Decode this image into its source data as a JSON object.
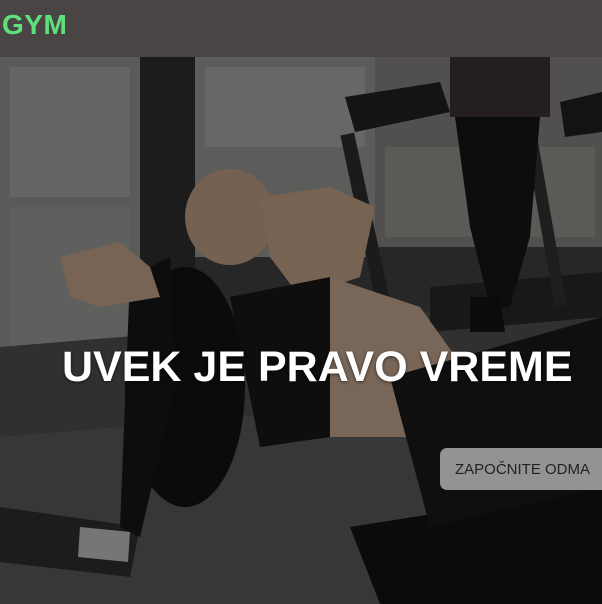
{
  "header": {
    "logo_text": "GYM"
  },
  "hero": {
    "headline": "UVEK JE PRAVO VREME",
    "cta_label": "ZAPOČNITE ODMA"
  },
  "colors": {
    "logo": "#5fe07a",
    "header_bg": "#4a4545",
    "cta_bg": "#aaaaaa",
    "headline": "#ffffff"
  }
}
